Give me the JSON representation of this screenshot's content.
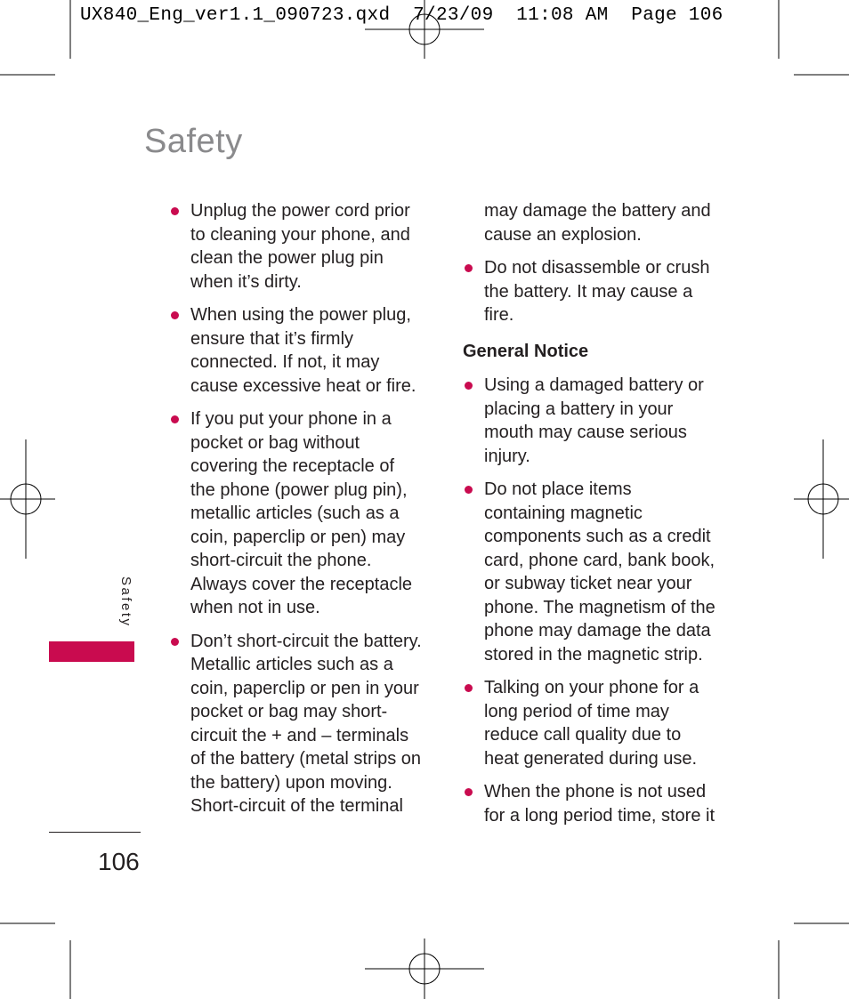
{
  "slug_line": "UX840_Eng_ver1.1_090723.qxd  7/23/09  11:08 AM  Page 106",
  "page_title": "Safety",
  "side_tab_label": "Safety",
  "accent_color": "#c90b4f",
  "page_number": "106",
  "column_left": {
    "bullets": [
      {
        "text": "Unplug the power cord prior to cleaning your phone, and clean the power plug pin when it’s dirty."
      },
      {
        "text": "When using the power plug, ensure that it’s firmly connected. If not, it may cause excessive heat or fire."
      },
      {
        "text": "If you put your phone in a pocket or bag without covering the receptacle of the phone (power plug pin), metallic articles (such as a coin, paperclip or pen) may short-circuit the phone. Always cover the receptacle when not in use."
      },
      {
        "text": "Don’t short-circuit the battery. Metallic articles such as a coin, paperclip or pen in your pocket or bag may short-circuit the + and – terminals of the battery (metal strips on the battery) upon moving. Short-circuit of the terminal"
      }
    ]
  },
  "column_right": {
    "continuation": "may damage the battery and cause an explosion.",
    "bullets_before": [
      {
        "text": "Do not disassemble or crush the battery. It may cause a fire."
      }
    ],
    "section_heading": "General Notice",
    "bullets_after": [
      {
        "text": "Using a damaged battery or placing a battery in your mouth may cause serious injury."
      },
      {
        "text": "Do not place items containing magnetic components such as a credit card, phone card, bank book, or subway ticket near your phone. The magnetism of the phone may damage the data stored in the magnetic strip."
      },
      {
        "text": "Talking on your phone for a long period of time may reduce call quality due to heat generated during use."
      },
      {
        "text": "When the phone is not used for a long period time, store it"
      }
    ]
  }
}
